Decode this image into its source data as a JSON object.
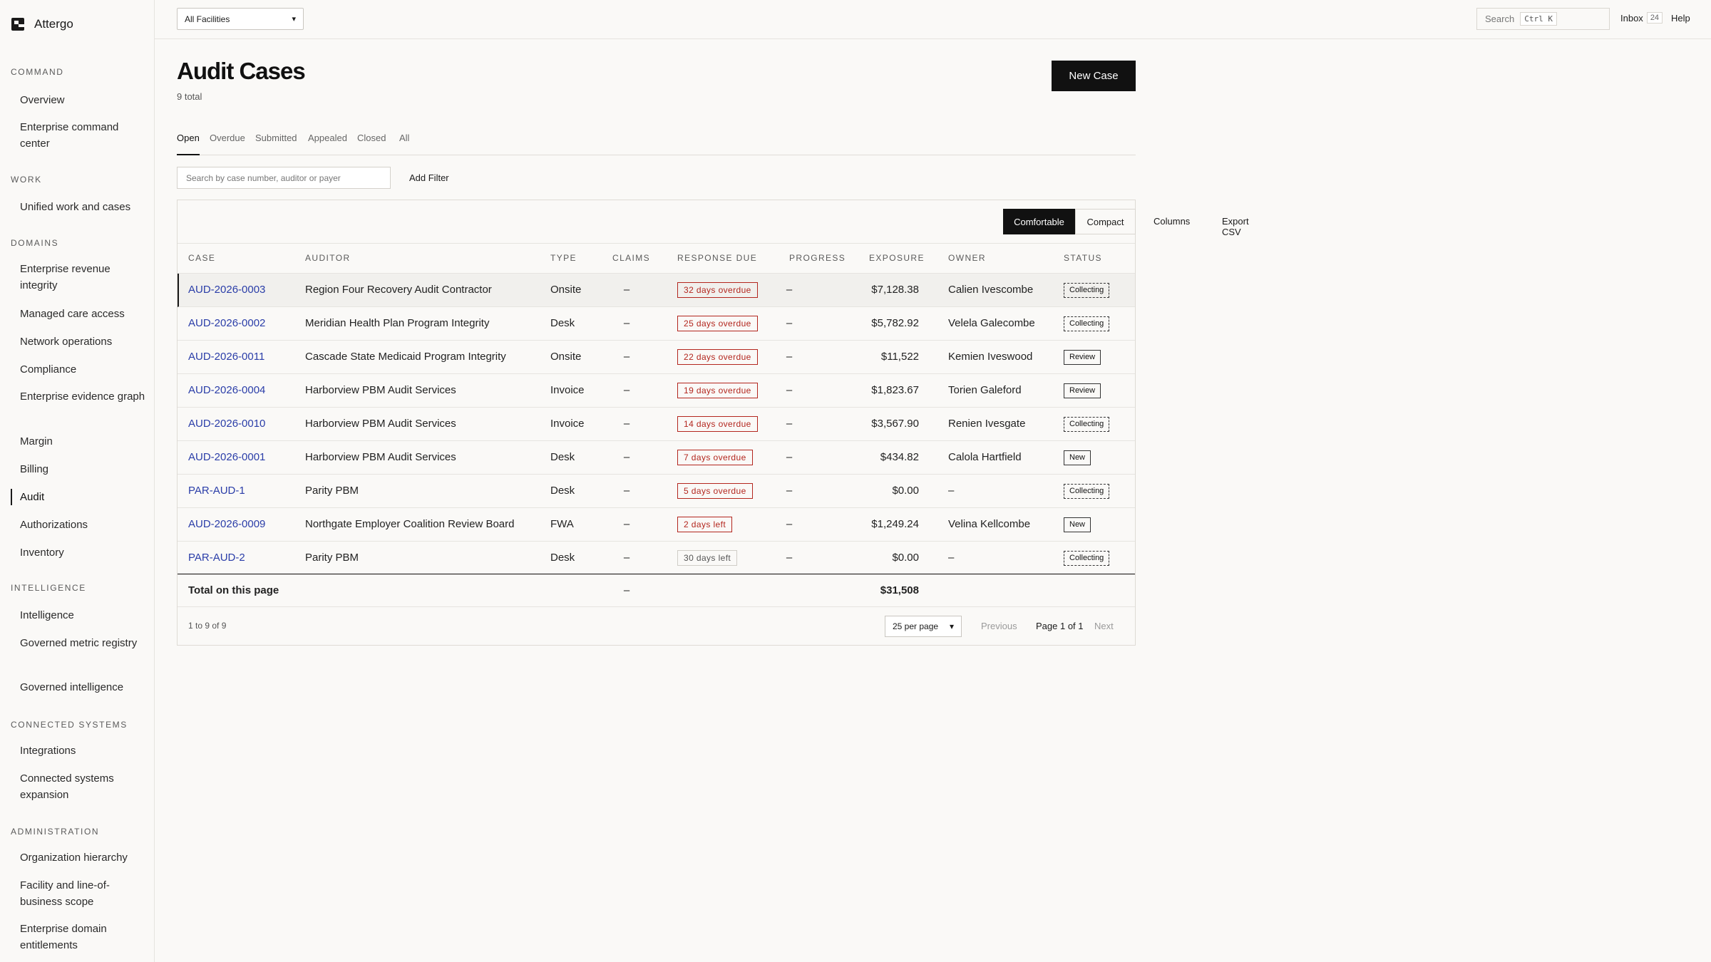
{
  "brand": {
    "name": "Attergo"
  },
  "sidebar": {
    "sections": [
      {
        "title": "COMMAND",
        "items": [
          {
            "label": "Overview"
          },
          {
            "label": "Enterprise command center"
          }
        ]
      },
      {
        "title": "WORK",
        "items": [
          {
            "label": "Unified work and cases"
          }
        ]
      },
      {
        "title": "DOMAINS",
        "items": [
          {
            "label": "Enterprise revenue integrity"
          },
          {
            "label": "Managed care access"
          },
          {
            "label": "Network operations"
          },
          {
            "label": "Compliance"
          },
          {
            "label": "Enterprise evidence graph"
          },
          {
            "label": "Margin"
          },
          {
            "label": "Billing"
          },
          {
            "label": "Audit",
            "active": true
          },
          {
            "label": "Authorizations"
          },
          {
            "label": "Inventory"
          }
        ]
      },
      {
        "title": "INTELLIGENCE",
        "items": [
          {
            "label": "Intelligence"
          },
          {
            "label": "Governed metric registry"
          },
          {
            "label": "Governed intelligence"
          }
        ]
      },
      {
        "title": "CONNECTED SYSTEMS",
        "items": [
          {
            "label": "Integrations"
          },
          {
            "label": "Connected systems expansion"
          }
        ]
      },
      {
        "title": "ADMINISTRATION",
        "items": [
          {
            "label": "Organization hierarchy"
          },
          {
            "label": "Facility and line-of-business scope"
          },
          {
            "label": "Enterprise domain entitlements"
          }
        ]
      }
    ]
  },
  "topbar": {
    "facility": "All Facilities",
    "search_label": "Search",
    "search_kbd": "Ctrl K",
    "inbox_label": "Inbox",
    "inbox_count": "24",
    "help_label": "Help"
  },
  "page": {
    "title": "Audit Cases",
    "total": "9 total",
    "new_case_label": "New Case",
    "tabs": [
      "Open",
      "Overdue",
      "Submitted",
      "Appealed",
      "Closed",
      "All"
    ],
    "active_tab": "Open",
    "filter_placeholder": "Search by case number, auditor or payer",
    "add_filter_label": "Add Filter"
  },
  "toolbar": {
    "comfortable": "Comfortable",
    "compact": "Compact",
    "columns": "Columns",
    "export": "Export CSV"
  },
  "table": {
    "headers": [
      "CASE",
      "AUDITOR",
      "TYPE",
      "CLAIMS",
      "RESPONSE DUE",
      "PROGRESS",
      "EXPOSURE",
      "OWNER",
      "STATUS"
    ],
    "rows": [
      {
        "case": "AUD-2026-0003",
        "auditor": "Region Four Recovery Audit Contractor",
        "type": "Onsite",
        "claims": "–",
        "due": "32 days overdue",
        "overdue": true,
        "progress": "–",
        "exposure": "$7,128.38",
        "owner": "Calien Ivescombe",
        "status": "Collecting",
        "status_style": "dashed"
      },
      {
        "case": "AUD-2026-0002",
        "auditor": "Meridian Health Plan Program Integrity",
        "type": "Desk",
        "claims": "–",
        "due": "25 days overdue",
        "overdue": true,
        "progress": "–",
        "exposure": "$5,782.92",
        "owner": "Velela Galecombe",
        "status": "Collecting",
        "status_style": "dashed"
      },
      {
        "case": "AUD-2026-0011",
        "auditor": "Cascade State Medicaid Program Integrity",
        "type": "Onsite",
        "claims": "–",
        "due": "22 days overdue",
        "overdue": true,
        "progress": "–",
        "exposure": "$11,522",
        "owner": "Kemien Iveswood",
        "status": "Review",
        "status_style": "solid"
      },
      {
        "case": "AUD-2026-0004",
        "auditor": "Harborview PBM Audit Services",
        "type": "Invoice",
        "claims": "–",
        "due": "19 days overdue",
        "overdue": true,
        "progress": "–",
        "exposure": "$1,823.67",
        "owner": "Torien Galeford",
        "status": "Review",
        "status_style": "solid"
      },
      {
        "case": "AUD-2026-0010",
        "auditor": "Harborview PBM Audit Services",
        "type": "Invoice",
        "claims": "–",
        "due": "14 days overdue",
        "overdue": true,
        "progress": "–",
        "exposure": "$3,567.90",
        "owner": "Renien Ivesgate",
        "status": "Collecting",
        "status_style": "dashed"
      },
      {
        "case": "AUD-2026-0001",
        "auditor": "Harborview PBM Audit Services",
        "type": "Desk",
        "claims": "–",
        "due": "7 days overdue",
        "overdue": true,
        "progress": "–",
        "exposure": "$434.82",
        "owner": "Calola Hartfield",
        "status": "New",
        "status_style": "solid"
      },
      {
        "case": "PAR-AUD-1",
        "auditor": "Parity PBM",
        "type": "Desk",
        "claims": "–",
        "due": "5 days overdue",
        "overdue": true,
        "progress": "–",
        "exposure": "$0.00",
        "owner": "–",
        "status": "Collecting",
        "status_style": "dashed"
      },
      {
        "case": "AUD-2026-0009",
        "auditor": "Northgate Employer Coalition Review Board",
        "type": "FWA",
        "claims": "–",
        "due": "2 days left",
        "overdue": true,
        "progress": "–",
        "exposure": "$1,249.24",
        "owner": "Velina Kellcombe",
        "status": "New",
        "status_style": "solid"
      },
      {
        "case": "PAR-AUD-2",
        "auditor": "Parity PBM",
        "type": "Desk",
        "claims": "–",
        "due": "30 days left",
        "overdue": false,
        "progress": "–",
        "exposure": "$0.00",
        "owner": "–",
        "status": "Collecting",
        "status_style": "dashed"
      }
    ],
    "total_label": "Total on this page",
    "total_claims": "–",
    "total_exposure": "$31,508"
  },
  "pager": {
    "range": "1 to 9 of 9",
    "per_page": "25 per page",
    "previous": "Previous",
    "page_of": "Page 1 of 1",
    "next": "Next"
  },
  "colors": {
    "accent": "#111111",
    "link": "#2a3da8",
    "overdue": "#b3261e"
  }
}
